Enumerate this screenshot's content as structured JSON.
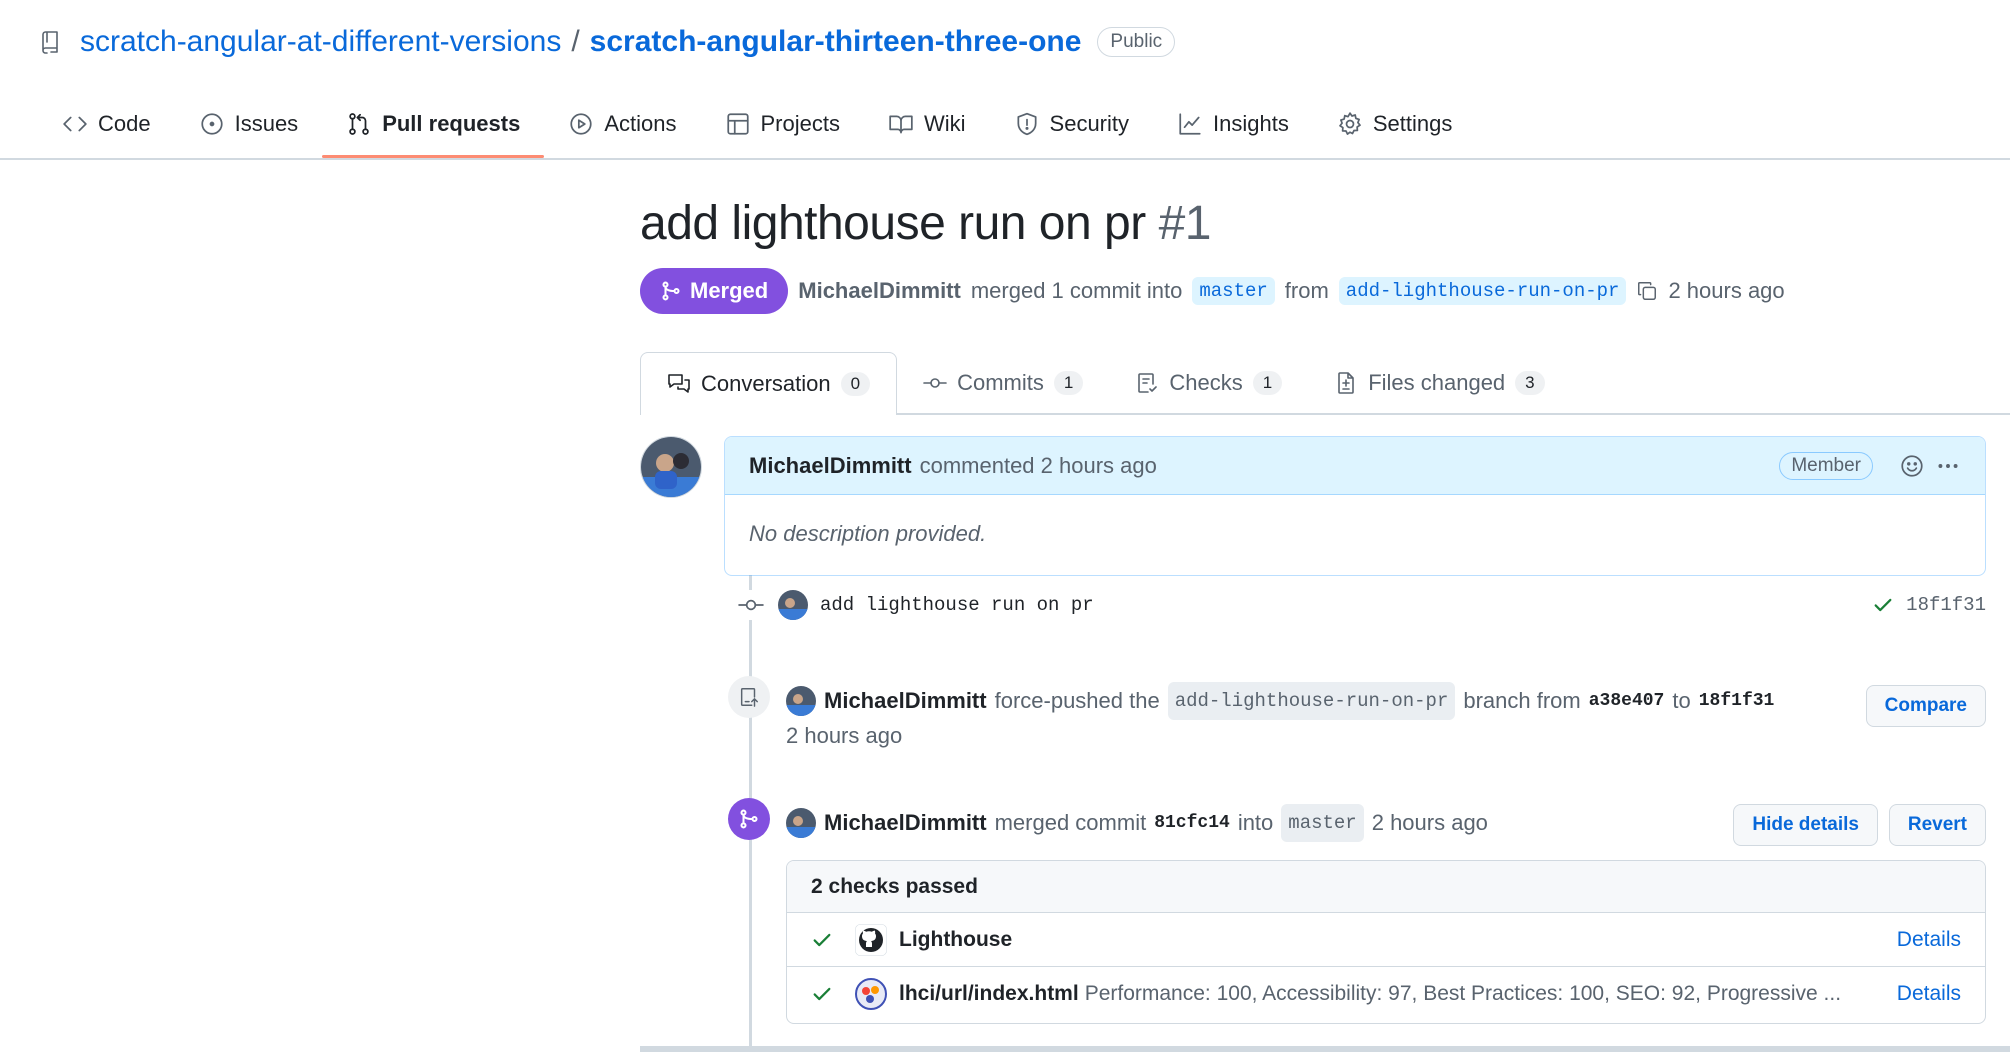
{
  "repo": {
    "owner": "scratch-angular-at-different-versions",
    "separator": "/",
    "name": "scratch-angular-thirteen-three-one",
    "visibility": "Public"
  },
  "nav": {
    "tabs": [
      {
        "label": "Code",
        "icon": "code-icon"
      },
      {
        "label": "Issues",
        "icon": "issue-icon"
      },
      {
        "label": "Pull requests",
        "icon": "pull-request-icon",
        "active": true
      },
      {
        "label": "Actions",
        "icon": "play-icon"
      },
      {
        "label": "Projects",
        "icon": "table-icon"
      },
      {
        "label": "Wiki",
        "icon": "book-icon"
      },
      {
        "label": "Security",
        "icon": "shield-icon"
      },
      {
        "label": "Insights",
        "icon": "graph-icon"
      },
      {
        "label": "Settings",
        "icon": "gear-icon"
      }
    ]
  },
  "pr": {
    "title": "add lighthouse run on pr",
    "number": "#1",
    "state": "Merged",
    "author": "MichaelDimmitt",
    "meta_merged": "merged 1 commit into",
    "base_branch": "master",
    "meta_from": "from",
    "head_branch": "add-lighthouse-run-on-pr",
    "time": "2 hours ago"
  },
  "pr_tabs": [
    {
      "label": "Conversation",
      "count": "0",
      "icon": "comment-discussion-icon",
      "active": true
    },
    {
      "label": "Commits",
      "count": "1",
      "icon": "commit-icon"
    },
    {
      "label": "Checks",
      "count": "1",
      "icon": "checklist-icon"
    },
    {
      "label": "Files changed",
      "count": "3",
      "icon": "file-diff-icon"
    }
  ],
  "comment": {
    "author": "MichaelDimmitt",
    "action": "commented 2 hours ago",
    "role": "Member",
    "body": "No description provided."
  },
  "commit": {
    "message": "add lighthouse run on pr",
    "sha": "18f1f31"
  },
  "force_push": {
    "author": "MichaelDimmitt",
    "text1": "force-pushed the",
    "branch": "add-lighthouse-run-on-pr",
    "text2": "branch from",
    "from_sha": "a38e407",
    "text3": "to",
    "to_sha": "18f1f31",
    "time": "2 hours ago",
    "compare_label": "Compare"
  },
  "merge_event": {
    "author": "MichaelDimmitt",
    "text1": "merged commit",
    "sha": "81cfc14",
    "text2": "into",
    "branch": "master",
    "time": "2 hours ago",
    "hide_label": "Hide details",
    "revert_label": "Revert"
  },
  "checks": {
    "summary": "2 checks passed",
    "items": [
      {
        "name": "Lighthouse",
        "description": "",
        "details": "Details"
      },
      {
        "name": "lhci/url/index.html",
        "description": "Performance: 100, Accessibility: 97, Best Practices: 100, SEO: 92, Progressive ...",
        "details": "Details"
      }
    ]
  },
  "colors": {
    "accent": "#0969da",
    "merged": "#8250df",
    "success": "#1a7f37",
    "tab_underline": "#fd8c73"
  }
}
